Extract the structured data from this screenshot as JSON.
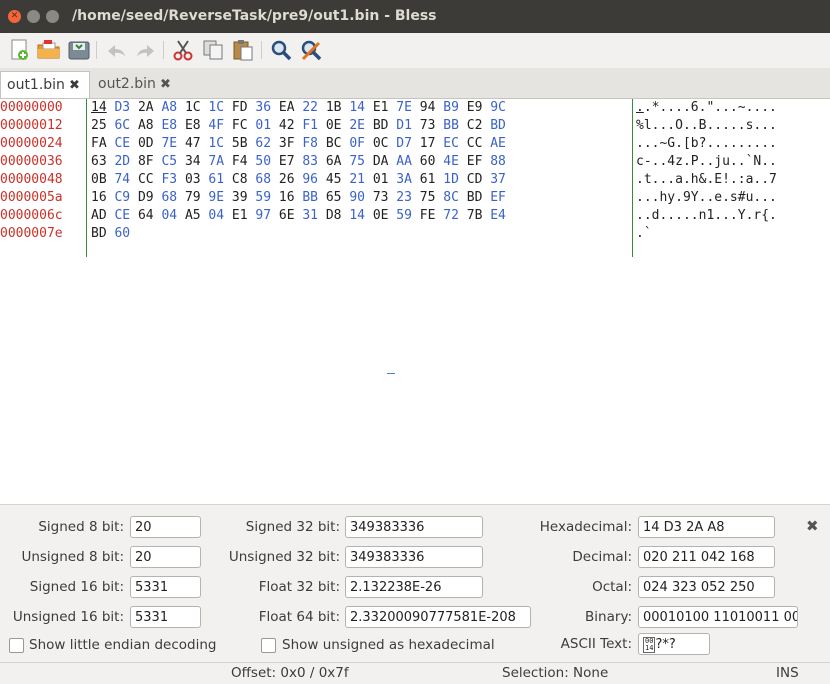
{
  "window": {
    "title": "/home/seed/ReverseTask/pre9/out1.bin - Bless"
  },
  "toolbar": {
    "buttons": [
      "new-file-icon",
      "open-folder-icon",
      "save-icon",
      "undo-icon",
      "redo-icon",
      "cut-icon",
      "copy-icon",
      "paste-icon",
      "find-icon",
      "find-replace-icon"
    ]
  },
  "tabs": [
    {
      "label": "out1.bin",
      "close": "✖"
    },
    {
      "label": "out2.bin",
      "close": "✖"
    }
  ],
  "hex": {
    "offsets": [
      "00000000",
      "00000012",
      "00000024",
      "00000036",
      "00000048",
      "0000005a",
      "0000006c",
      "0000007e"
    ],
    "rows": [
      [
        "14",
        "D3",
        "2A",
        "A8",
        "1C",
        "1C",
        "FD",
        "36",
        "EA",
        "22",
        "1B",
        "14",
        "E1",
        "7E",
        "94",
        "B9",
        "E9",
        "9C"
      ],
      [
        "25",
        "6C",
        "A8",
        "E8",
        "E8",
        "4F",
        "FC",
        "01",
        "42",
        "F1",
        "0E",
        "2E",
        "BD",
        "D1",
        "73",
        "BB",
        "C2",
        "BD"
      ],
      [
        "FA",
        "CE",
        "0D",
        "7E",
        "47",
        "1C",
        "5B",
        "62",
        "3F",
        "F8",
        "BC",
        "0F",
        "0C",
        "D7",
        "17",
        "EC",
        "CC",
        "AE"
      ],
      [
        "63",
        "2D",
        "8F",
        "C5",
        "34",
        "7A",
        "F4",
        "50",
        "E7",
        "83",
        "6A",
        "75",
        "DA",
        "AA",
        "60",
        "4E",
        "EF",
        "88"
      ],
      [
        "0B",
        "74",
        "CC",
        "F3",
        "03",
        "61",
        "C8",
        "68",
        "26",
        "96",
        "45",
        "21",
        "01",
        "3A",
        "61",
        "1D",
        "CD",
        "37"
      ],
      [
        "16",
        "C9",
        "D9",
        "68",
        "79",
        "9E",
        "39",
        "59",
        "16",
        "BB",
        "65",
        "90",
        "73",
        "23",
        "75",
        "8C",
        "BD",
        "EF"
      ],
      [
        "AD",
        "CE",
        "64",
        "04",
        "A5",
        "04",
        "E1",
        "97",
        "6E",
        "31",
        "D8",
        "14",
        "0E",
        "59",
        "FE",
        "72",
        "7B",
        "E4"
      ],
      [
        "BD",
        "60"
      ]
    ],
    "ascii": [
      "..*....6.\"...~....",
      "%l...O..B.....s...",
      "...~G.[b?.........",
      "c-..4z.P..ju..`N..",
      ".t...a.h&.E!.:a..7",
      "...hy.9Y..e.s#u...",
      "..d.....n1...Y.r{.",
      ".`"
    ]
  },
  "conversion": {
    "signed8_label": "Signed 8 bit:",
    "signed8": "20",
    "unsigned8_label": "Unsigned 8 bit:",
    "unsigned8": "20",
    "signed16_label": "Signed 16 bit:",
    "signed16": "5331",
    "unsigned16_label": "Unsigned 16 bit:",
    "unsigned16": "5331",
    "signed32_label": "Signed 32 bit:",
    "signed32": "349383336",
    "unsigned32_label": "Unsigned 32 bit:",
    "unsigned32": "349383336",
    "float32_label": "Float 32 bit:",
    "float32": "2.132238E-26",
    "float64_label": "Float 64 bit:",
    "float64": "2.33200090777581E-208",
    "hex_label": "Hexadecimal:",
    "hex": "14 D3 2A A8",
    "dec_label": "Decimal:",
    "dec": "020 211 042 168",
    "oct_label": "Octal:",
    "oct": "024 323 052 250",
    "bin_label": "Binary:",
    "bin": "00010100 11010011 00",
    "ascii_label": "ASCII Text:",
    "ascii": "?*?",
    "little_endian_label": "Show little endian decoding",
    "unsigned_hex_label": "Show unsigned as hexadecimal",
    "close": "✖"
  },
  "status": {
    "offset": "Offset: 0x0 / 0x7f",
    "selection": "Selection: None",
    "mode": "INS"
  },
  "colors": {
    "offset": "#c8322b",
    "hex_blue": "#3b62c8",
    "separator": "#3a8a3a"
  }
}
